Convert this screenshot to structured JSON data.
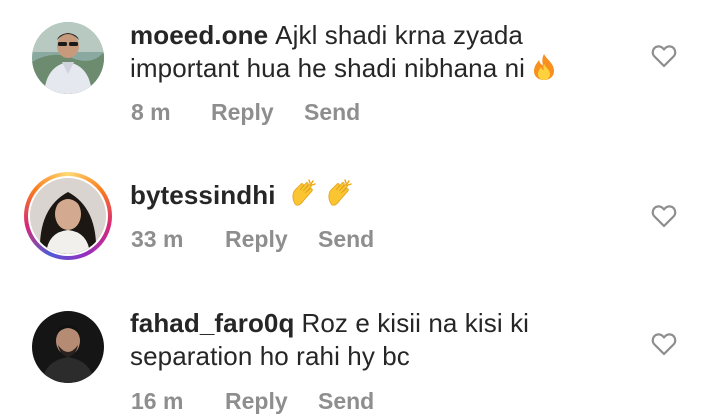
{
  "comments": [
    {
      "username": "moeed.one",
      "text": "Ajkl shadi krna zyada important hua he shadi nibhana ni",
      "emoji": "fire-emoji",
      "time": "8 m",
      "reply_label": "Reply",
      "send_label": "Send",
      "has_story": false
    },
    {
      "username": "bytessindhi",
      "text": "",
      "emoji": "clapping-hands-emoji x2",
      "time": "33 m",
      "reply_label": "Reply",
      "send_label": "Send",
      "has_story": true
    },
    {
      "username": "fahad_faro0q",
      "text": "Roz e kisii na kisi ki separation ho rahi hy bc",
      "time": "16 m",
      "reply_label": "Reply",
      "send_label": "Send",
      "has_story": false
    }
  ],
  "colors": {
    "text": "#262626",
    "meta": "#8e8e8e",
    "heart_outline": "#8e8e8e"
  }
}
